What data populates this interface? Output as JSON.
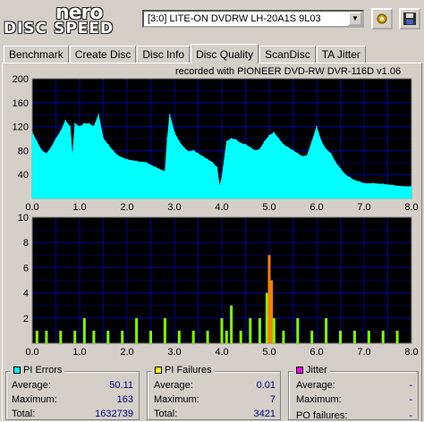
{
  "app": {
    "logo_top": "nero",
    "logo_bottom": "DISC SPEED"
  },
  "toolbar": {
    "drive": "[3:0]  LITE-ON DVDRW LH-20A1S 9L03"
  },
  "tabs": [
    {
      "label": "Benchmark"
    },
    {
      "label": "Create Disc"
    },
    {
      "label": "Disc Info"
    },
    {
      "label": "Disc Quality"
    },
    {
      "label": "ScanDisc"
    },
    {
      "label": "TA Jitter"
    }
  ],
  "recorded_text": "recorded with PIONEER DVD-RW  DVR-116D v1.06",
  "chart_data": [
    {
      "type": "area",
      "name": "read speed / PI errors",
      "x_ticks": [
        "0.0",
        "1.0",
        "2.0",
        "3.0",
        "4.0",
        "5.0",
        "6.0",
        "7.0",
        "8.0"
      ],
      "y_ticks": [
        "200",
        "160",
        "120",
        "80",
        "40"
      ],
      "xlim": [
        0,
        8
      ],
      "ylim": [
        0,
        200
      ],
      "grid": true,
      "colors": {
        "fill": "#00ffff",
        "background": "#000000",
        "grid": "#0000a0"
      },
      "x": [
        0.0,
        0.1,
        0.2,
        0.3,
        0.4,
        0.5,
        0.6,
        0.7,
        0.8,
        0.85,
        0.9,
        1.0,
        1.1,
        1.2,
        1.3,
        1.4,
        1.5,
        1.6,
        1.7,
        1.8,
        1.9,
        2.0,
        2.2,
        2.4,
        2.6,
        2.8,
        2.85,
        2.9,
        3.0,
        3.1,
        3.2,
        3.3,
        3.4,
        3.5,
        3.6,
        3.7,
        3.8,
        3.9,
        3.95,
        4.0,
        4.1,
        4.2,
        4.3,
        4.4,
        4.5,
        4.6,
        4.7,
        4.8,
        4.9,
        5.0,
        5.1,
        5.2,
        5.3,
        5.4,
        5.5,
        5.6,
        5.7,
        5.8,
        5.9,
        6.0,
        6.1,
        6.2,
        6.3,
        6.4,
        6.5,
        6.6,
        6.7,
        6.8,
        6.9,
        7.0,
        7.2,
        7.4,
        7.6,
        7.8,
        8.0
      ],
      "y": [
        110,
        95,
        80,
        75,
        85,
        100,
        112,
        130,
        120,
        70,
        125,
        120,
        125,
        125,
        120,
        140,
        100,
        90,
        80,
        72,
        68,
        65,
        62,
        60,
        52,
        45,
        100,
        140,
        110,
        95,
        85,
        78,
        80,
        75,
        70,
        65,
        60,
        52,
        20,
        35,
        95,
        100,
        98,
        92,
        90,
        85,
        80,
        82,
        95,
        105,
        110,
        100,
        90,
        85,
        80,
        75,
        70,
        72,
        95,
        120,
        95,
        82,
        75,
        60,
        50,
        40,
        35,
        30,
        28,
        25,
        25,
        24,
        22,
        20,
        20
      ]
    },
    {
      "type": "bar",
      "name": "PI failures",
      "x_ticks": [
        "0.0",
        "1.0",
        "2.0",
        "3.0",
        "4.0",
        "5.0",
        "6.0",
        "7.0",
        "8.0"
      ],
      "y_ticks": [
        "10",
        "8",
        "6",
        "4",
        "2"
      ],
      "xlim": [
        0,
        8
      ],
      "ylim": [
        0,
        10
      ],
      "grid": true,
      "colors": {
        "bar": "#80ff00",
        "spike": "#ff8000",
        "background": "#000000",
        "grid": "#0000a0"
      },
      "x": [
        0.1,
        0.3,
        0.6,
        0.9,
        1.1,
        1.3,
        1.6,
        1.9,
        2.2,
        2.5,
        2.8,
        3.1,
        3.4,
        3.7,
        4.0,
        4.1,
        4.2,
        4.4,
        4.6,
        4.8,
        4.95,
        5.0,
        5.05,
        5.1,
        5.3,
        5.6,
        5.9,
        6.2,
        6.5,
        6.8,
        7.1,
        7.4,
        7.7
      ],
      "values": [
        1,
        1,
        1,
        1,
        2,
        1,
        1,
        1,
        2,
        1,
        2,
        1,
        1,
        1,
        2,
        1,
        3,
        1,
        2,
        2,
        4,
        7,
        5,
        2,
        1,
        2,
        1,
        2,
        1,
        1,
        1,
        1,
        1
      ]
    }
  ],
  "stats": {
    "pi_errors": {
      "title": "PI Errors",
      "color": "#00ffff",
      "avg_label": "Average:",
      "avg": "50.11",
      "max_label": "Maximum:",
      "max": "163",
      "total_label": "Total:",
      "total": "1632739"
    },
    "pi_failures": {
      "title": "PI Failures",
      "color": "#ffff00",
      "avg_label": "Average:",
      "avg": "0.01",
      "max_label": "Maximum:",
      "max": "7",
      "total_label": "Total:",
      "total": "3421"
    },
    "jitter": {
      "title": "Jitter",
      "color": "#ff00ff",
      "avg_label": "Average:",
      "avg": "-",
      "max_label": "Maximum:",
      "max": "-",
      "po_label": "PO failures:",
      "po": "-"
    }
  }
}
